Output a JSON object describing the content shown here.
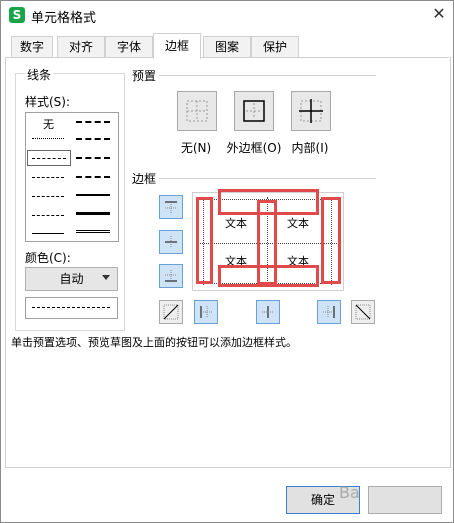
{
  "dialog": {
    "title": "单元格格式",
    "app_icon_glyph": "S"
  },
  "tabs": [
    {
      "label": "数字"
    },
    {
      "label": "对齐"
    },
    {
      "label": "字体"
    },
    {
      "label": "边框",
      "active": true
    },
    {
      "label": "图案"
    },
    {
      "label": "保护"
    }
  ],
  "line_group": {
    "title": "线条",
    "style_label": "样式(S):",
    "none_label": "无",
    "color_label": "颜色(C):",
    "color_value": "自动"
  },
  "preset_group": {
    "title": "预置",
    "buttons": [
      {
        "label": "无(N)"
      },
      {
        "label": "外边框(O)"
      },
      {
        "label": "内部(I)"
      }
    ]
  },
  "border_group": {
    "title": "边框",
    "cell_text": "文本"
  },
  "hint_text": "单击预置选项、预览草图及上面的按钮可以添加边框样式。",
  "buttons": {
    "ok": "确定"
  },
  "watermark": "Ba",
  "colors": {
    "highlight_red": "#e04a4a",
    "button_blue_fill": "#cfe3f7",
    "button_blue_border": "#6aa0d8"
  }
}
